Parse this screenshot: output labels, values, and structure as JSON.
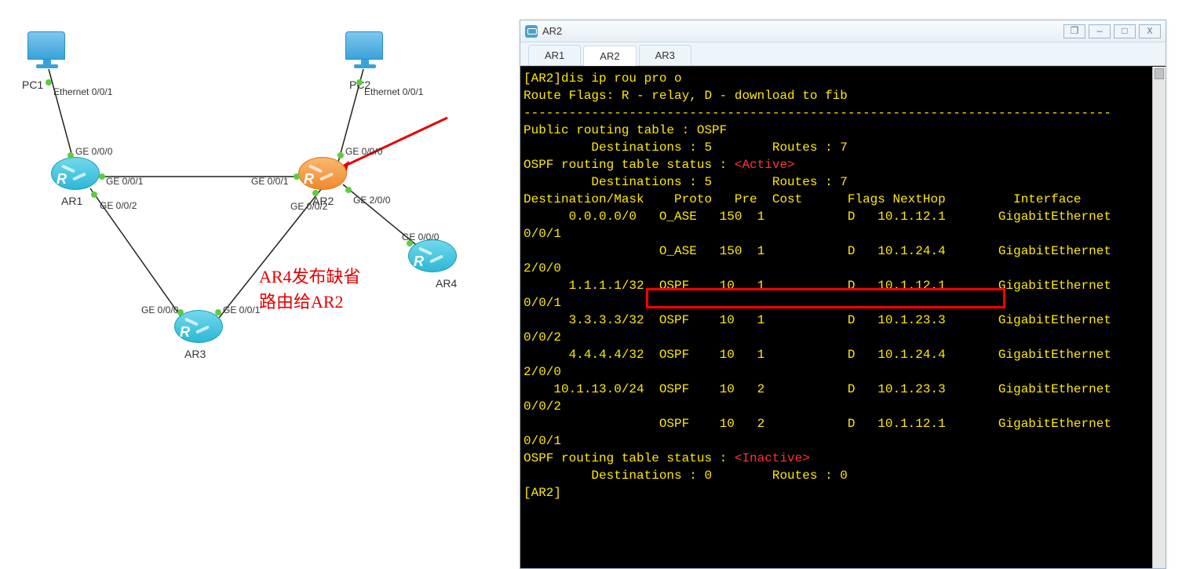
{
  "topology": {
    "pc1": {
      "label": "PC1",
      "if": "Ethernet 0/0/1"
    },
    "pc2": {
      "label": "PC2",
      "if": "Ethernet 0/0/1"
    },
    "ar1": {
      "label": "AR1"
    },
    "ar2_node": {
      "label": "AR2"
    },
    "ar3": {
      "label": "AR3"
    },
    "ar4": {
      "label": "AR4"
    },
    "ifs": {
      "ar1_ge000": "GE 0/0/0",
      "ar1_ge001": "GE 0/0/1",
      "ar1_ge002": "GE 0/0/2",
      "ar2_ge000": "GE 0/0/0",
      "ar2_ge001": "GE 0/0/1",
      "ar2_ge002": "GE 0/0/2",
      "ar2_ge200": "GE 2/0/0",
      "ar3_ge000": "GE 0/0/0",
      "ar3_ge001": "GE 0/0/1",
      "ar4_ge000": "GE 0/0/0"
    },
    "annotation_line1": "AR4发布缺省",
    "annotation_line2": "路由给AR2"
  },
  "window": {
    "title": "AR2",
    "tabs": [
      "AR1",
      "AR2",
      "AR3"
    ],
    "active_tab": 1,
    "btn_restore": "❐",
    "btn_min": "—",
    "btn_max": "□",
    "btn_close": "X"
  },
  "term": {
    "l0": "[AR2]dis ip rou pro o",
    "l1": "Route Flags: R - relay, D - download to fib",
    "l2": "------------------------------------------------------------------------------",
    "l3": "Public routing table : OSPF",
    "l4": "         Destinations : 5        Routes : 7",
    "l5": "",
    "l6": "OSPF routing table status : ",
    "l6a": "<Active>",
    "l7": "         Destinations : 5        Routes : 7",
    "l8": "",
    "l9": "Destination/Mask    Proto   Pre  Cost      Flags NextHop         Interface",
    "l10": "",
    "l11": "      0.0.0.0/0   O_ASE   150  1           D   10.1.12.1       GigabitEthernet",
    "l12": "0/0/1",
    "l13": "                  O_ASE   150  1           D   10.1.24.4       GigabitEthernet",
    "l14": "2/0/0",
    "l15": "      1.1.1.1/32  OSPF    10   1           D   10.1.12.1       GigabitEthernet",
    "l16": "0/0/1",
    "l17": "      3.3.3.3/32  OSPF    10   1           D   10.1.23.3       GigabitEthernet",
    "l18": "0/0/2",
    "l19": "      4.4.4.4/32  OSPF    10   1           D   10.1.24.4       GigabitEthernet",
    "l20": "2/0/0",
    "l21": "    10.1.13.0/24  OSPF    10   2           D   10.1.23.3       GigabitEthernet",
    "l22": "0/0/2",
    "l23": "                  OSPF    10   2           D   10.1.12.1       GigabitEthernet",
    "l24": "0/0/1",
    "l25": "",
    "l26": "OSPF routing table status : ",
    "l26a": "<Inactive>",
    "l27": "         Destinations : 0        Routes : 0",
    "l28": "",
    "l29": "[AR2]"
  }
}
